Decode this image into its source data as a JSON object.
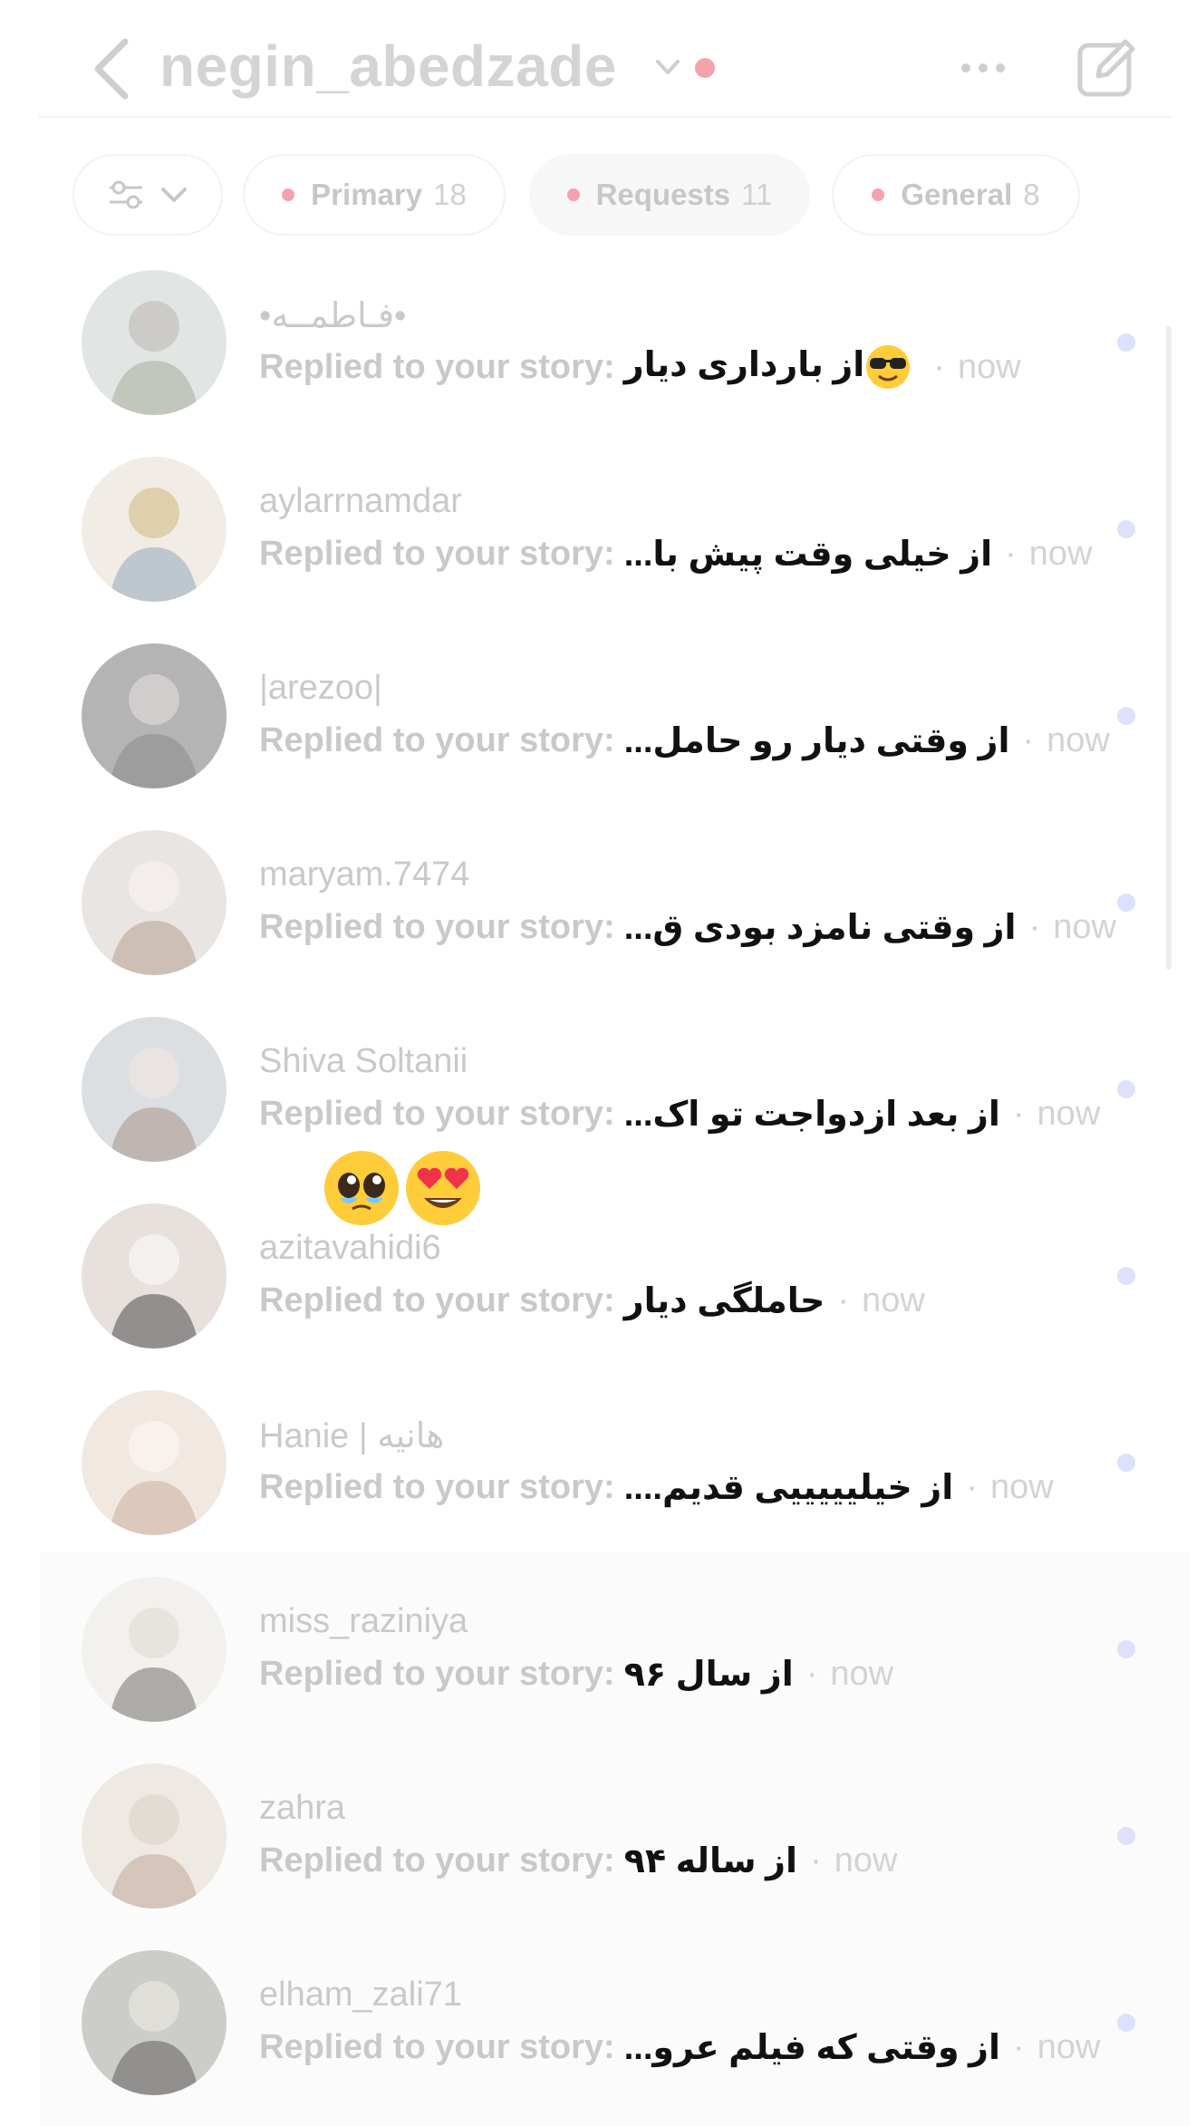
{
  "header": {
    "title": "negin_abedzade",
    "back_icon": "chevron-left-icon",
    "more_icon": "more-horizontal-icon",
    "compose_icon": "compose-icon",
    "status_dot_color": "#f5a3ab"
  },
  "chips": {
    "filter_icon": "sliders-icon",
    "primary": {
      "label": "Primary",
      "count": "18"
    },
    "requests": {
      "label": "Requests",
      "count": "11"
    },
    "general": {
      "label": "General",
      "count": "8"
    }
  },
  "threads": [
    {
      "username": "•فـاطمــه•",
      "prefix": "Replied to your story:",
      "reply": "از بارداری دیار",
      "time": "now",
      "has_emoji": true
    },
    {
      "username": "aylarrnamdar",
      "prefix": "Replied to your story:",
      "reply": "از خیلی وقت پیش با...",
      "time": "now"
    },
    {
      "username": "|arezoo|",
      "prefix": "Replied to your story:",
      "reply": "از وقتی دیار رو حامل...",
      "time": "now"
    },
    {
      "username": "maryam.7474",
      "prefix": "Replied to your story:",
      "reply": "از وقتی نامزد بودی ق...",
      "time": "now"
    },
    {
      "username": "Shiva Soltanii",
      "prefix": "Replied to your story:",
      "reply": "از بعد ازدواجت تو اک...",
      "time": "now"
    },
    {
      "username": "azitavahidi6",
      "prefix": "Replied to your story:",
      "reply": "حاملگی دیار",
      "time": "now"
    },
    {
      "username": "Hanie | هانیه",
      "prefix": "Replied to your story:",
      "reply": "از خیلیییییی قدیم....",
      "time": "now"
    },
    {
      "username": "miss_raziniya",
      "prefix": "Replied to your story:",
      "reply": "از سال ۹۶",
      "time": "now"
    },
    {
      "username": "zahra",
      "prefix": "Replied to your story:",
      "reply": "از ساله ۹۴",
      "time": "now"
    },
    {
      "username": "elham_zali71",
      "prefix": "Replied to your story:",
      "reply": "از وقتی که فیلم عرو...",
      "time": "now"
    }
  ],
  "floating_emojis": [
    "pleading-face-emoji",
    "heart-eyes-emoji"
  ],
  "colors": {
    "unread_dot": "#dde1fb",
    "chip_dot": "#f5a3ab"
  }
}
